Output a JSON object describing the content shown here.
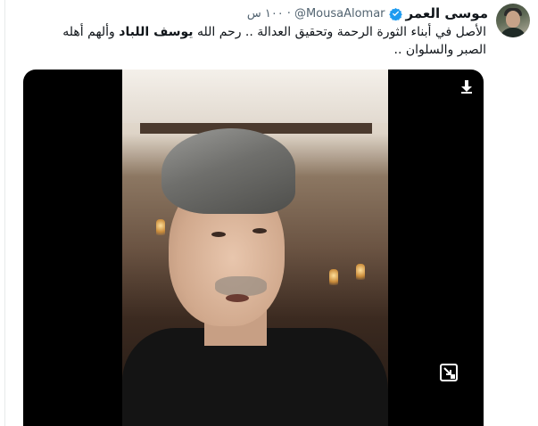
{
  "tweet": {
    "display_name": "موسى العمر",
    "handle": "@MousaAlomar",
    "separator": "·",
    "time": "١٠٠ س",
    "text_part1": "الأصل في أبناء الثورة الرحمة وتحقيق العدالة .. رحم الله ",
    "text_bold": "يوسف اللباد",
    "text_part2": " وألهم أهله الصبر والسلوان .."
  },
  "icons": {
    "verified": "verified-badge-icon",
    "download": "download-icon",
    "expand": "expand-video-icon"
  },
  "colors": {
    "verified": "#1d9bf0",
    "text": "#0f1419",
    "muted": "#536471",
    "media_bg": "#000000"
  }
}
